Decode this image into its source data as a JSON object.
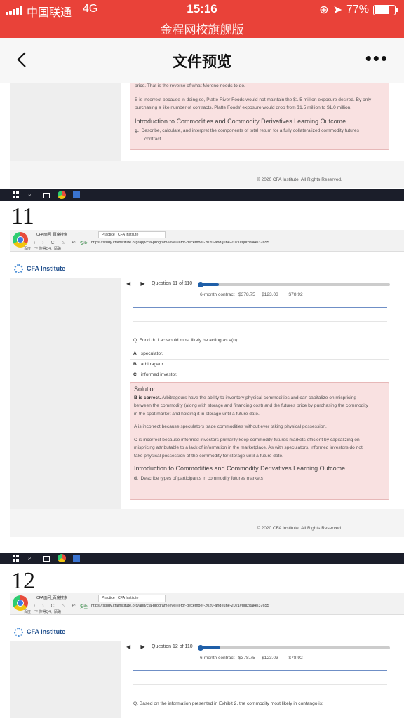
{
  "status": {
    "carrier": "中国联通",
    "network": "4G",
    "time": "15:16",
    "battery": "77%"
  },
  "app": {
    "title": "金程网校旗舰版"
  },
  "nav": {
    "title": "文件预览"
  },
  "page10_tail": {
    "line1": "price. That is the reverse of what Moreno needs to do.",
    "b_incorrect": "B is incorrect because in doing so, Platte River Foods would not maintain the $1.5 million exposure desired. By only",
    "b_incorrect2": "purchasing a like number of contracts, Platte Foods' exposure would drop from $1.5 million to $1.0 million.",
    "heading": "Introduction to Commodities and Commodity Derivatives Learning Outcome",
    "outcome_letter": "g.",
    "outcome": "Describe, calculate, and interpret the components of total return for a fully collateralized commodity futures",
    "outcome2": "contract",
    "copyright": "© 2020 CFA Institute. All Rights Reserved."
  },
  "browser": {
    "tab1": "CFA面问_百度搜索",
    "tab2": "Practice | CFA Institute",
    "secure": "安全",
    "url": "https://study.cfainstitute.org/app/cfa-program-level-ii-for-december-2020-and-june-2021#quiz/take/37655",
    "bookmarks": "百度一下   你得Q4、陌路一!",
    "cfa_brand": "CFA Institute"
  },
  "page11": {
    "number": "11",
    "question_label": "Question 11 of 110",
    "progress": 0.1,
    "contract_label": "6-month contract",
    "c1": "$378.75",
    "c2": "$123.03",
    "c3": "$78.92",
    "question": "Q. Fond du Lac would most likely be acting as a(n):",
    "options": [
      {
        "letter": "A",
        "text": "speculator."
      },
      {
        "letter": "B",
        "text": "arbitrageur."
      },
      {
        "letter": "C",
        "text": "informed investor."
      }
    ],
    "solution_title": "Solution",
    "solution_b_bold": "B is correct.",
    "solution_b": "Arbitrageurs have the ability to inventory physical commodities and can capitalize on mispricing",
    "solution_b2": "between the commodity (along with storage and financing cost) and the futures price by purchasing the commodity",
    "solution_b3": "in the spot market and holding it in storage until a future date.",
    "solution_a": "A is incorrect because speculators trade commodities without ever taking physical possession.",
    "solution_c": "C is incorrect because informed investors primarily keep commodity futures markets efficient by capitalizing on",
    "solution_c2": "mispricing attributable to a lack of information in the marketplace. As with speculators, informed investors do not",
    "solution_c3": "take physical possession of the commodity for storage until a future date.",
    "heading": "Introduction to Commodities and Commodity Derivatives Learning Outcome",
    "outcome_letter": "d.",
    "outcome": "Describe types of participants in commodity futures markets",
    "copyright": "© 2020 CFA Institute. All Rights Reserved."
  },
  "page12": {
    "number": "12",
    "question_label": "Question 12 of 110",
    "progress": 0.11,
    "contract_label": "6-month contract",
    "c1": "$378.75",
    "c2": "$123.03",
    "c3": "$78.92",
    "question": "Q. Based on the information presented in Exhibit 2, the commodity most likely in contango is:"
  }
}
